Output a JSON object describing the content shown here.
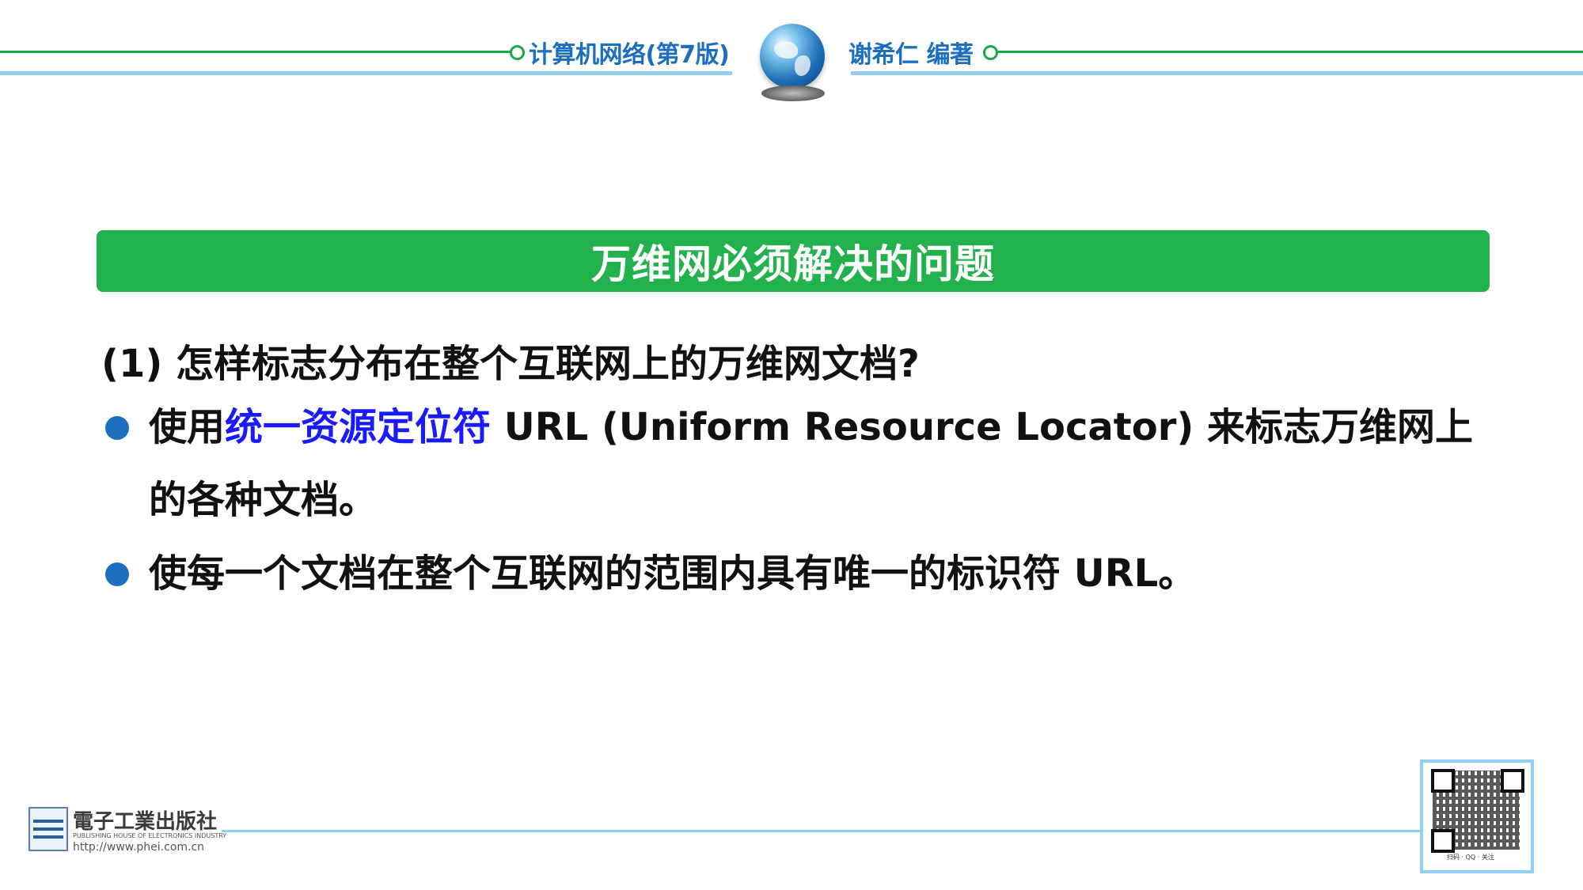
{
  "header": {
    "book_title": "计算机网络(第7版)",
    "author": "谢希仁 编著"
  },
  "slide": {
    "title": "万维网必须解决的问题",
    "question": "(1) 怎样标志分布在整个互联网上的万维网文档?",
    "bullets": [
      {
        "prefix": "使用",
        "highlight": "统一资源定位符",
        "suffix": " URL (Uniform Resource Locator) 来标志万维网上的各种文档。"
      },
      {
        "text": "使每一个文档在整个互联网的范围内具有唯一的标识符 URL。"
      }
    ]
  },
  "footer": {
    "publisher_cn": "電子工業出版社",
    "publisher_en": "PUBLISHING HOUSE OF ELECTRONICS INDUSTRY",
    "publisher_url": "http://www.phei.com.cn",
    "qr_caption": "扫码 · QQ · 关注"
  },
  "colors": {
    "accent_green": "#22b14c",
    "header_blue": "#1c6fc0",
    "highlight_blue": "#1a1aff",
    "line_light_blue": "#8fd0f0"
  }
}
